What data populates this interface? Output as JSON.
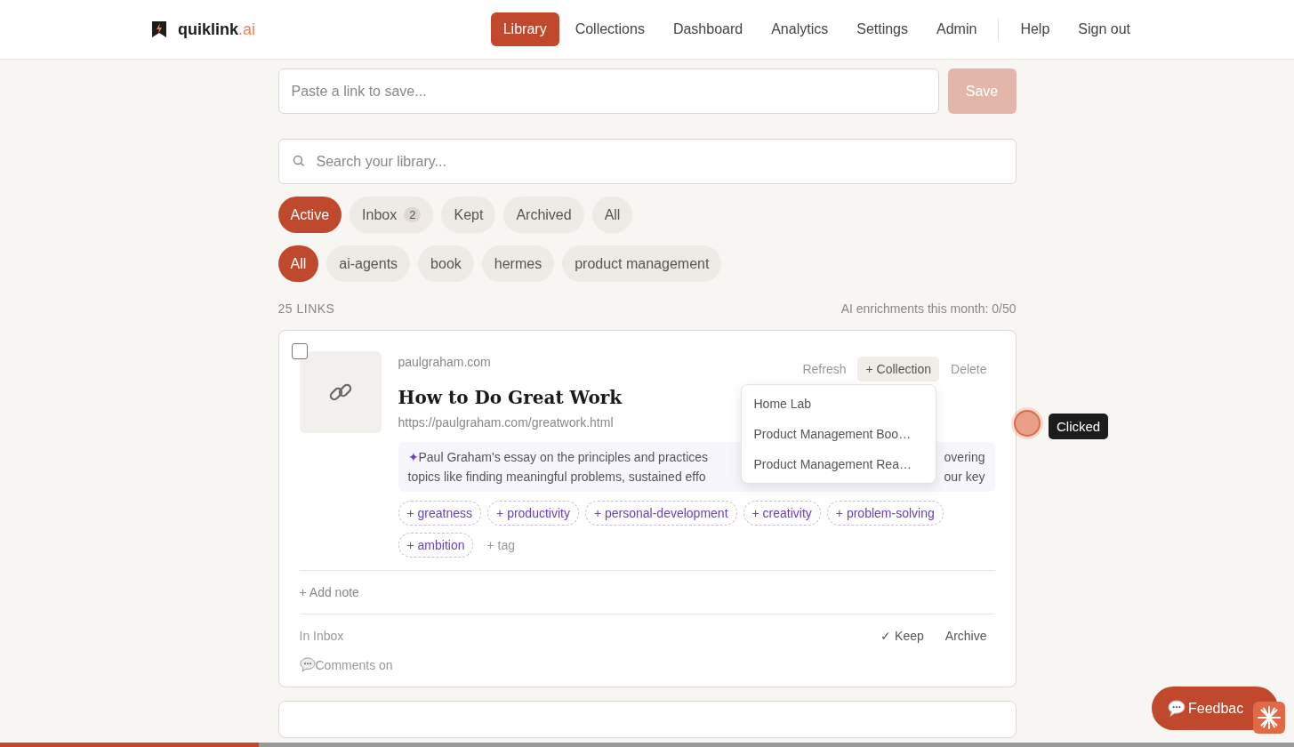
{
  "brand": {
    "name": "quiklink",
    "suffix": ".ai"
  },
  "nav": [
    {
      "label": "Library",
      "selected": true
    },
    {
      "label": "Collections",
      "selected": false
    },
    {
      "label": "Dashboard",
      "selected": false
    },
    {
      "label": "Analytics",
      "selected": false
    },
    {
      "label": "Settings",
      "selected": false
    },
    {
      "label": "Admin",
      "selected": false
    }
  ],
  "nav_secondary": [
    "Help",
    "Sign out"
  ],
  "save_form": {
    "placeholder": "Paste a link to save...",
    "button": "Save",
    "disabled": true
  },
  "search": {
    "placeholder": "Search your library..."
  },
  "status_filters": [
    {
      "label": "Active",
      "selected": true
    },
    {
      "label": "Inbox",
      "count": "2",
      "selected": false
    },
    {
      "label": "Kept",
      "selected": false
    },
    {
      "label": "Archived",
      "selected": false
    },
    {
      "label": "All",
      "selected": false
    }
  ],
  "tag_filters": [
    {
      "label": "All",
      "selected": true
    },
    {
      "label": "ai-agents",
      "selected": false
    },
    {
      "label": "book",
      "selected": false
    },
    {
      "label": "hermes",
      "selected": false
    },
    {
      "label": "product management",
      "selected": false
    }
  ],
  "summary_bar": {
    "count": "25 LINKS",
    "enrichments": "AI enrichments this month: 0/50"
  },
  "links": [
    {
      "checked": false,
      "domain": "paulgraham.com",
      "title": "How to Do Great Work",
      "url": "https://paulgraham.com/greatwork.html",
      "actions": [
        "Refresh",
        "+ Collection",
        "Delete"
      ],
      "collection_menu": [
        "Home Lab",
        "Product Management Boo…",
        "Product Management Rea…"
      ],
      "ai_mark": "✦",
      "summary_lines": [
        {
          "left": "Paul Graham's essay on the principles and practices",
          "right": "overing"
        },
        {
          "left": "topics like finding meaningful problems, sustained effo",
          "right": "our key"
        }
      ],
      "tags": [
        "+ greatness",
        "+ productivity",
        "+ personal-development",
        "+ creativity",
        "+ problem-solving",
        "+ ambition"
      ],
      "add_tag": "+ tag",
      "add_note": "+ Add note",
      "status": "In Inbox",
      "keep": "✓ Keep",
      "archive": "Archive",
      "comments": "Comments on"
    }
  ],
  "click_tooltip": "Clicked",
  "feedback": {
    "label": "Feedbac"
  },
  "page_progress": {
    "level": 0.2
  }
}
